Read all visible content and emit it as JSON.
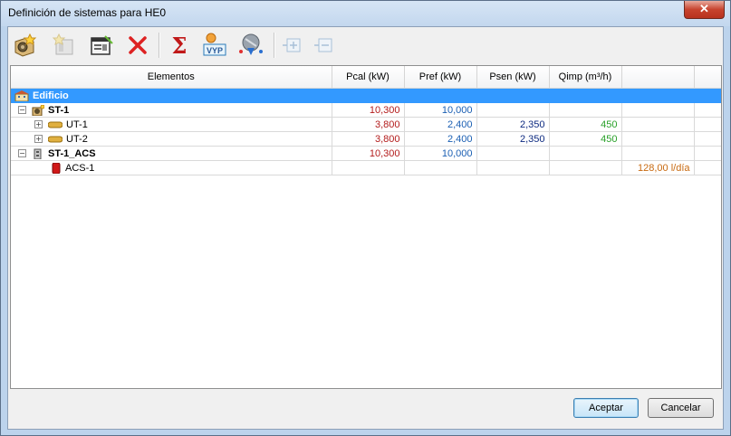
{
  "window": {
    "title": "Definición de sistemas para HE0",
    "close_glyph": "✕"
  },
  "toolbar": {
    "items": [
      {
        "icon": "new-system-icon",
        "enabled": true
      },
      {
        "icon": "new-unit-icon",
        "enabled": false
      },
      {
        "icon": "edit-icon",
        "enabled": true
      },
      {
        "icon": "delete-icon",
        "enabled": true
      },
      {
        "icon": "sum-icon",
        "glyph": "Σ",
        "enabled": true
      },
      {
        "icon": "vyp-icon",
        "glyph": "VYP",
        "enabled": true
      },
      {
        "icon": "import-icon",
        "enabled": true
      },
      {
        "icon": "expand-all-icon",
        "enabled": false
      },
      {
        "icon": "collapse-all-icon",
        "enabled": false
      }
    ]
  },
  "table": {
    "headers": [
      "Elementos",
      "Pcal (kW)",
      "Pref (kW)",
      "Psen (kW)",
      "Qimp (m³/h)",
      "",
      ""
    ],
    "rows": [
      {
        "label": "Edificio",
        "pcal": "",
        "pref": "",
        "psen": "",
        "qimp": "",
        "extra": ""
      },
      {
        "label": "ST-1",
        "pcal": "10,300",
        "pref": "10,000",
        "psen": "",
        "qimp": "",
        "extra": ""
      },
      {
        "label": "UT-1",
        "pcal": "3,800",
        "pref": "2,400",
        "psen": "2,350",
        "qimp": "450",
        "extra": ""
      },
      {
        "label": "UT-2",
        "pcal": "3,800",
        "pref": "2,400",
        "psen": "2,350",
        "qimp": "450",
        "extra": ""
      },
      {
        "label": "ST-1_ACS",
        "pcal": "10,300",
        "pref": "10,000",
        "psen": "",
        "qimp": "",
        "extra": ""
      },
      {
        "label": "ACS-1",
        "pcal": "",
        "pref": "",
        "psen": "",
        "qimp": "",
        "extra": "128,00 l/día"
      }
    ],
    "tree_glyphs": {
      "minus": "−",
      "plus": "+"
    }
  },
  "buttons": {
    "accept": "Aceptar",
    "cancel": "Cancelar"
  },
  "colors": {
    "selection": "#3399ff",
    "pcal": "#b31b1b",
    "pref": "#1b5fb3",
    "psen": "#0d2a80",
    "qimp": "#28a028",
    "acs": "#c86a10"
  }
}
